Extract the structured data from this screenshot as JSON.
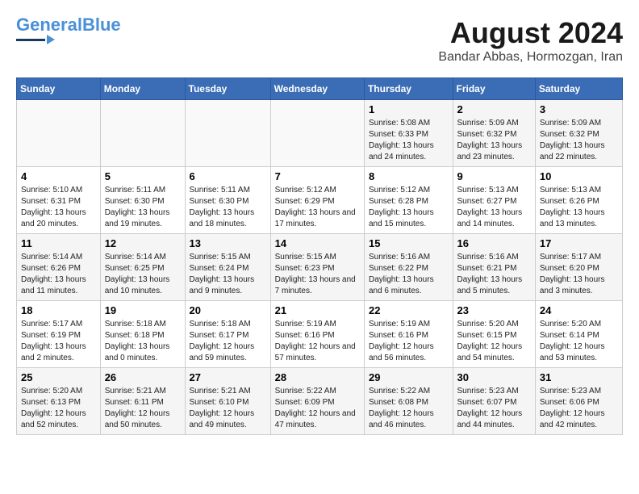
{
  "logo": {
    "line1": "General",
    "line2": "Blue"
  },
  "title": "August 2024",
  "subtitle": "Bandar Abbas, Hormozgan, Iran",
  "days_of_week": [
    "Sunday",
    "Monday",
    "Tuesday",
    "Wednesday",
    "Thursday",
    "Friday",
    "Saturday"
  ],
  "weeks": [
    [
      {
        "num": "",
        "info": ""
      },
      {
        "num": "",
        "info": ""
      },
      {
        "num": "",
        "info": ""
      },
      {
        "num": "",
        "info": ""
      },
      {
        "num": "1",
        "info": "Sunrise: 5:08 AM\nSunset: 6:33 PM\nDaylight: 13 hours and 24 minutes."
      },
      {
        "num": "2",
        "info": "Sunrise: 5:09 AM\nSunset: 6:32 PM\nDaylight: 13 hours and 23 minutes."
      },
      {
        "num": "3",
        "info": "Sunrise: 5:09 AM\nSunset: 6:32 PM\nDaylight: 13 hours and 22 minutes."
      }
    ],
    [
      {
        "num": "4",
        "info": "Sunrise: 5:10 AM\nSunset: 6:31 PM\nDaylight: 13 hours and 20 minutes."
      },
      {
        "num": "5",
        "info": "Sunrise: 5:11 AM\nSunset: 6:30 PM\nDaylight: 13 hours and 19 minutes."
      },
      {
        "num": "6",
        "info": "Sunrise: 5:11 AM\nSunset: 6:30 PM\nDaylight: 13 hours and 18 minutes."
      },
      {
        "num": "7",
        "info": "Sunrise: 5:12 AM\nSunset: 6:29 PM\nDaylight: 13 hours and 17 minutes."
      },
      {
        "num": "8",
        "info": "Sunrise: 5:12 AM\nSunset: 6:28 PM\nDaylight: 13 hours and 15 minutes."
      },
      {
        "num": "9",
        "info": "Sunrise: 5:13 AM\nSunset: 6:27 PM\nDaylight: 13 hours and 14 minutes."
      },
      {
        "num": "10",
        "info": "Sunrise: 5:13 AM\nSunset: 6:26 PM\nDaylight: 13 hours and 13 minutes."
      }
    ],
    [
      {
        "num": "11",
        "info": "Sunrise: 5:14 AM\nSunset: 6:26 PM\nDaylight: 13 hours and 11 minutes."
      },
      {
        "num": "12",
        "info": "Sunrise: 5:14 AM\nSunset: 6:25 PM\nDaylight: 13 hours and 10 minutes."
      },
      {
        "num": "13",
        "info": "Sunrise: 5:15 AM\nSunset: 6:24 PM\nDaylight: 13 hours and 9 minutes."
      },
      {
        "num": "14",
        "info": "Sunrise: 5:15 AM\nSunset: 6:23 PM\nDaylight: 13 hours and 7 minutes."
      },
      {
        "num": "15",
        "info": "Sunrise: 5:16 AM\nSunset: 6:22 PM\nDaylight: 13 hours and 6 minutes."
      },
      {
        "num": "16",
        "info": "Sunrise: 5:16 AM\nSunset: 6:21 PM\nDaylight: 13 hours and 5 minutes."
      },
      {
        "num": "17",
        "info": "Sunrise: 5:17 AM\nSunset: 6:20 PM\nDaylight: 13 hours and 3 minutes."
      }
    ],
    [
      {
        "num": "18",
        "info": "Sunrise: 5:17 AM\nSunset: 6:19 PM\nDaylight: 13 hours and 2 minutes."
      },
      {
        "num": "19",
        "info": "Sunrise: 5:18 AM\nSunset: 6:18 PM\nDaylight: 13 hours and 0 minutes."
      },
      {
        "num": "20",
        "info": "Sunrise: 5:18 AM\nSunset: 6:17 PM\nDaylight: 12 hours and 59 minutes."
      },
      {
        "num": "21",
        "info": "Sunrise: 5:19 AM\nSunset: 6:16 PM\nDaylight: 12 hours and 57 minutes."
      },
      {
        "num": "22",
        "info": "Sunrise: 5:19 AM\nSunset: 6:16 PM\nDaylight: 12 hours and 56 minutes."
      },
      {
        "num": "23",
        "info": "Sunrise: 5:20 AM\nSunset: 6:15 PM\nDaylight: 12 hours and 54 minutes."
      },
      {
        "num": "24",
        "info": "Sunrise: 5:20 AM\nSunset: 6:14 PM\nDaylight: 12 hours and 53 minutes."
      }
    ],
    [
      {
        "num": "25",
        "info": "Sunrise: 5:20 AM\nSunset: 6:13 PM\nDaylight: 12 hours and 52 minutes."
      },
      {
        "num": "26",
        "info": "Sunrise: 5:21 AM\nSunset: 6:11 PM\nDaylight: 12 hours and 50 minutes."
      },
      {
        "num": "27",
        "info": "Sunrise: 5:21 AM\nSunset: 6:10 PM\nDaylight: 12 hours and 49 minutes."
      },
      {
        "num": "28",
        "info": "Sunrise: 5:22 AM\nSunset: 6:09 PM\nDaylight: 12 hours and 47 minutes."
      },
      {
        "num": "29",
        "info": "Sunrise: 5:22 AM\nSunset: 6:08 PM\nDaylight: 12 hours and 46 minutes."
      },
      {
        "num": "30",
        "info": "Sunrise: 5:23 AM\nSunset: 6:07 PM\nDaylight: 12 hours and 44 minutes."
      },
      {
        "num": "31",
        "info": "Sunrise: 5:23 AM\nSunset: 6:06 PM\nDaylight: 12 hours and 42 minutes."
      }
    ]
  ]
}
